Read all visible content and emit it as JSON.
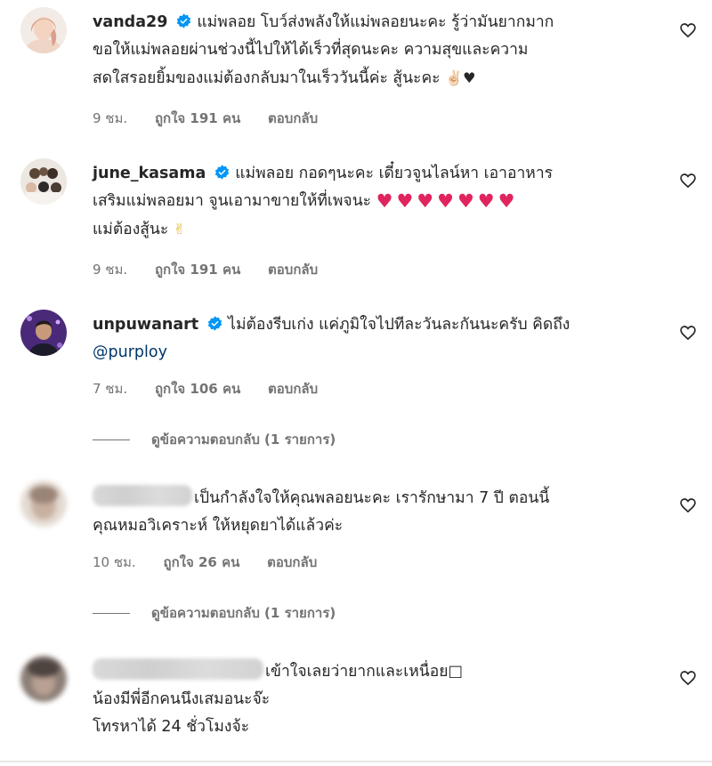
{
  "comments": [
    {
      "username": "vanda29",
      "verified": true,
      "lines": [
        "แม่พลอย โบว์ส่งพลังให้แม่พลอยนะคะ รู้ว่ามันยากมาก",
        "ขอให้แม่พลอยผ่านช่วงนี้ไปให้ได้เร็วที่สุดนะคะ ความสุขและความ",
        "สดใสรอยยิ้มของแม่ต้องกลับมาในเร็ววันนี้ค่ะ สู้นะคะ"
      ],
      "line3_emoji": "✌🏻♥",
      "time": "9 ชม.",
      "likes": "ถูกใจ 191 คน",
      "reply": "ตอบกลับ"
    },
    {
      "username": "june_kasama",
      "verified": true,
      "lines": [
        "แม่พลอย กอดๆนะคะ เดี๋ยวจูนไลน์หา เอาอาหาร",
        "เสริมแม่พลอยมา จูนเอามาขายให้ที่เพจนะ",
        "แม่ต้องสู้นะ"
      ],
      "line2_emoji": "♥♥♥♥♥♥♥",
      "line3_emoji": "✌",
      "time": "9 ชม.",
      "likes": "ถูกใจ 191 คน",
      "reply": "ตอบกลับ"
    },
    {
      "username": "unpuwanart",
      "verified": true,
      "lines": [
        "ไม่ต้องรีบเก่ง แค่ภูมิใจไปทีละวันละกันนะครับ คิดถึง"
      ],
      "mention": "@purploy",
      "time": "7 ชม.",
      "likes": "ถูกใจ 106 คน",
      "reply": "ตอบกลับ",
      "view_replies": "ดูข้อความตอบกลับ (1 รายการ)"
    },
    {
      "username": "",
      "verified": false,
      "lines": [
        "เป็นกำลังใจให้คุณพลอยนะคะ เรารักษามา 7 ปี ตอนนี้",
        "คุณหมอวิเคราะห์ ให้หยุดยาได้แล้วค่ะ"
      ],
      "time": "10 ชม.",
      "likes": "ถูกใจ 26 คน",
      "reply": "ตอบกลับ",
      "view_replies": "ดูข้อความตอบกลับ (1 รายการ)"
    },
    {
      "username": "",
      "verified": false,
      "lines": [
        "เข้าใจเลยว่ายากและเหนื่อย",
        "น้องมีพี่อีกคนนึงเสมอนะจ๊ะ",
        "โทรหาได้ 24 ชั่วโมงจ้ะ"
      ],
      "line1_suffix": "□"
    }
  ],
  "colors": {
    "text": "#262626",
    "muted": "#737373",
    "verified_badge": "#0095f6",
    "mention": "#00376b",
    "heart_emoji": "#e0245e"
  },
  "icons": {
    "like": "heart-outline-icon",
    "verified": "verified-badge-icon"
  }
}
